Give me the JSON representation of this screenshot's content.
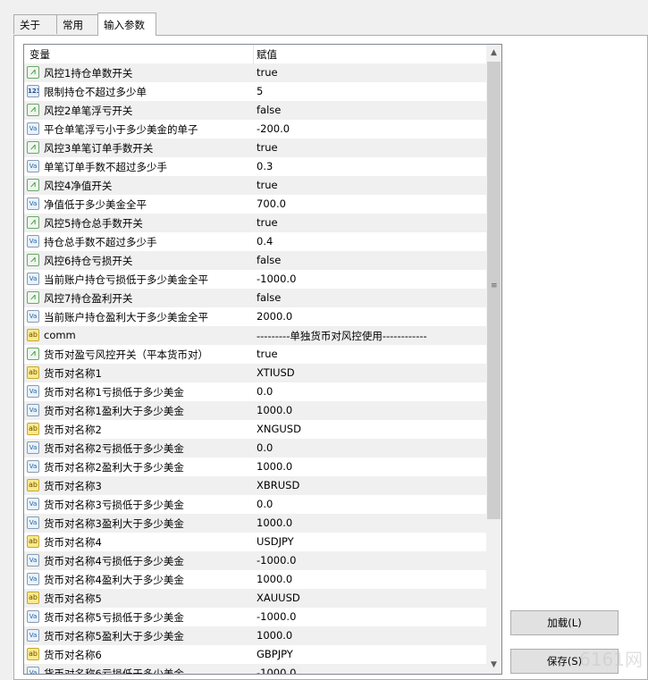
{
  "tabs": [
    {
      "label": "关于"
    },
    {
      "label": "常用"
    },
    {
      "label": "输入参数",
      "active": true
    }
  ],
  "grid": {
    "col_variable": "变量",
    "col_value": "赋值",
    "rows": [
      {
        "type": "bool",
        "name": "风控1持仓单数开关",
        "value": "true"
      },
      {
        "type": "int",
        "name": "限制持仓不超过多少单",
        "value": "5"
      },
      {
        "type": "bool",
        "name": "风控2单笔浮亏开关",
        "value": "false"
      },
      {
        "type": "dbl",
        "name": "平仓单笔浮亏小于多少美金的单子",
        "value": "-200.0"
      },
      {
        "type": "bool",
        "name": "风控3单笔订单手数开关",
        "value": "true"
      },
      {
        "type": "dbl",
        "name": "单笔订单手数不超过多少手",
        "value": "0.3"
      },
      {
        "type": "bool",
        "name": "风控4净值开关",
        "value": "true"
      },
      {
        "type": "dbl",
        "name": "净值低于多少美金全平",
        "value": "700.0"
      },
      {
        "type": "bool",
        "name": "风控5持仓总手数开关",
        "value": "true"
      },
      {
        "type": "dbl",
        "name": "持仓总手数不超过多少手",
        "value": "0.4"
      },
      {
        "type": "bool",
        "name": "风控6持仓亏损开关",
        "value": "false"
      },
      {
        "type": "dbl",
        "name": "当前账户持仓亏损低于多少美金全平",
        "value": "-1000.0"
      },
      {
        "type": "bool",
        "name": "风控7持仓盈利开关",
        "value": "false"
      },
      {
        "type": "dbl",
        "name": "当前账户持仓盈利大于多少美金全平",
        "value": "2000.0"
      },
      {
        "type": "str",
        "name": "comm",
        "value": "---------单独货币对风控使用------------"
      },
      {
        "type": "bool",
        "name": "货币对盈亏风控开关（平本货币对）",
        "value": "true"
      },
      {
        "type": "str",
        "name": "货币对名称1",
        "value": "XTIUSD"
      },
      {
        "type": "dbl",
        "name": "货币对名称1亏损低于多少美金",
        "value": "0.0"
      },
      {
        "type": "dbl",
        "name": "货币对名称1盈利大于多少美金",
        "value": "1000.0"
      },
      {
        "type": "str",
        "name": "货币对名称2",
        "value": "XNGUSD"
      },
      {
        "type": "dbl",
        "name": "货币对名称2亏损低于多少美金",
        "value": "0.0"
      },
      {
        "type": "dbl",
        "name": "货币对名称2盈利大于多少美金",
        "value": "1000.0"
      },
      {
        "type": "str",
        "name": "货币对名称3",
        "value": "XBRUSD"
      },
      {
        "type": "dbl",
        "name": "货币对名称3亏损低于多少美金",
        "value": "0.0"
      },
      {
        "type": "dbl",
        "name": "货币对名称3盈利大于多少美金",
        "value": "1000.0"
      },
      {
        "type": "str",
        "name": "货币对名称4",
        "value": "USDJPY"
      },
      {
        "type": "dbl",
        "name": "货币对名称4亏损低于多少美金",
        "value": "-1000.0"
      },
      {
        "type": "dbl",
        "name": "货币对名称4盈利大于多少美金",
        "value": "1000.0"
      },
      {
        "type": "str",
        "name": "货币对名称5",
        "value": "XAUUSD"
      },
      {
        "type": "dbl",
        "name": "货币对名称5亏损低于多少美金",
        "value": "-1000.0"
      },
      {
        "type": "dbl",
        "name": "货币对名称5盈利大于多少美金",
        "value": "1000.0"
      },
      {
        "type": "str",
        "name": "货币对名称6",
        "value": "GBPJPY"
      },
      {
        "type": "dbl",
        "name": "货币对名称6亏损低于多少美金",
        "value": "-1000.0"
      }
    ]
  },
  "icons": {
    "bool": "line-chart-icon",
    "int": "integer-123-icon",
    "dbl": "double-value-icon",
    "str": "string-ab-icon"
  },
  "icon_glyphs": {
    "bool": "⩘",
    "int": "123",
    "dbl": "Va",
    "str": "ab"
  },
  "buttons": {
    "load": "加载(L)",
    "save": "保存(S)"
  },
  "watermark": "6161网"
}
